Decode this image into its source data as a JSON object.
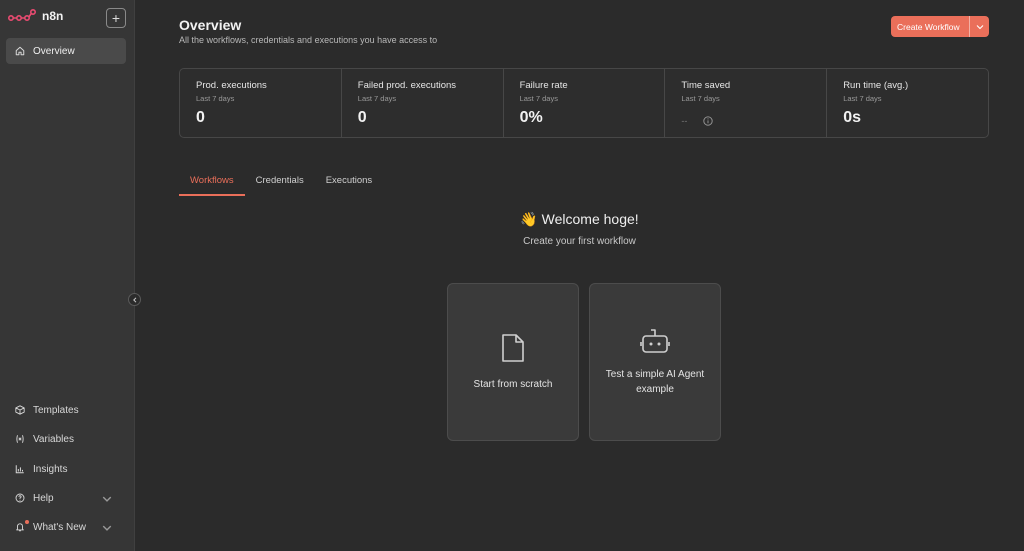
{
  "app": {
    "name": "n8n"
  },
  "colors": {
    "accent": "#ea6f5a",
    "sidebar_bg": "#363636",
    "main_bg": "#2b2b2b"
  },
  "sidebar": {
    "new_icon": "plus-icon",
    "top_items": [
      {
        "label": "Overview",
        "icon": "home-icon",
        "active": true
      }
    ],
    "bottom_items": [
      {
        "label": "Templates",
        "icon": "package-icon"
      },
      {
        "label": "Variables",
        "icon": "variable-icon"
      },
      {
        "label": "Insights",
        "icon": "chart-bar-icon"
      },
      {
        "label": "Help",
        "icon": "question-icon",
        "expandable": true
      },
      {
        "label": "What's New",
        "icon": "bell-icon",
        "expandable": true,
        "has_notification": true
      }
    ]
  },
  "header": {
    "title": "Overview",
    "subtitle": "All the workflows, credentials and executions you have access to",
    "create_button": "Create Workflow"
  },
  "stats": [
    {
      "label": "Prod. executions",
      "period": "Last 7 days",
      "value": "0"
    },
    {
      "label": "Failed prod. executions",
      "period": "Last 7 days",
      "value": "0"
    },
    {
      "label": "Failure rate",
      "period": "Last 7 days",
      "value": "0%"
    },
    {
      "label": "Time saved",
      "period": "Last 7 days",
      "value": "--"
    },
    {
      "label": "Run time (avg.)",
      "period": "Last 7 days",
      "value": "0s"
    }
  ],
  "tabs": [
    {
      "label": "Workflows",
      "active": true
    },
    {
      "label": "Credentials",
      "active": false
    },
    {
      "label": "Executions",
      "active": false
    }
  ],
  "welcome": {
    "emoji": "👋",
    "title": "Welcome hoge!",
    "subtitle": "Create your first workflow"
  },
  "cards": [
    {
      "label": "Start from scratch",
      "icon": "file-icon"
    },
    {
      "label": "Test a simple AI Agent example",
      "icon": "robot-icon"
    }
  ]
}
